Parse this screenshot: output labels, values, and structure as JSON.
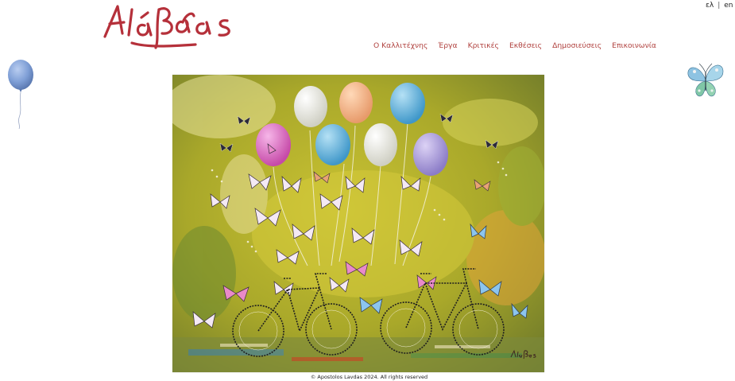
{
  "header": {
    "logo_alt": "Λάβδας"
  },
  "language": {
    "options": [
      "ελ",
      "en"
    ],
    "separator": "|"
  },
  "nav": {
    "items": [
      {
        "label": "Ο Καλλιτέχνης"
      },
      {
        "label": "Έργα"
      },
      {
        "label": "Κριτικές"
      },
      {
        "label": "Εκθέσεις"
      },
      {
        "label": "Δημοσιεύσεις"
      },
      {
        "label": "Επικοινωνία"
      }
    ]
  },
  "colors": {
    "brand_red": "#b0413e",
    "balloon_blue": "#7f9fd6"
  },
  "painting": {
    "signature": "Λάβδας"
  },
  "footer": {
    "copyright": "© Apostolos Lavdas 2024. All rights reserved"
  }
}
